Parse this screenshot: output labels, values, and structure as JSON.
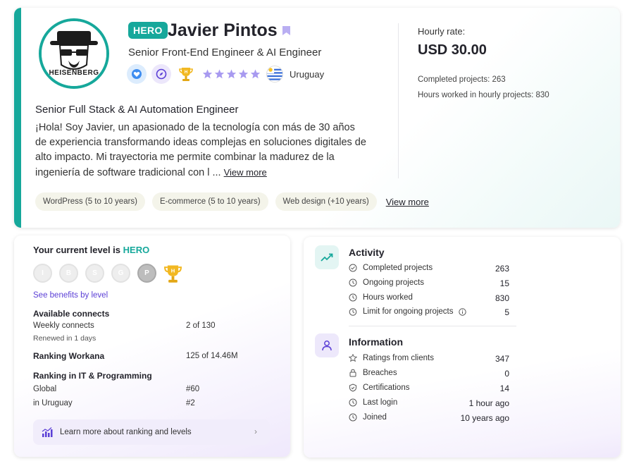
{
  "profile": {
    "badge": "HERO",
    "name": "Javier Pintos",
    "subtitle": "Senior Front-End Engineer & AI Engineer",
    "country": "Uruguay",
    "avatar_text": "HEISENBERG",
    "headline": "Senior Full Stack & AI Automation Engineer",
    "bio": "¡Hola! Soy Javier, un apasionado de la tecnología con más de 30 años de experiencia transformando ideas complejas en soluciones digitales de alto impacto. Mi trayectoria me permite combinar la madurez de la ingeniería de software tradicional con l ...",
    "bio_more": "View more",
    "skills": [
      "WordPress (5 to 10 years)",
      "E-commerce (5 to 10 years)",
      "Web design (+10 years)"
    ],
    "skills_more": "View more",
    "rating_stars": 5
  },
  "rate": {
    "label": "Hourly rate:",
    "value": "USD 30.00",
    "completed": "Completed projects: 263",
    "hours": "Hours worked in hourly projects: 830"
  },
  "level": {
    "title_prefix": "Your current level is",
    "title_level": "HERO",
    "level_badges": [
      "I",
      "B",
      "S",
      "G",
      "P",
      "H"
    ],
    "benefits_link": "See benefits by level",
    "connects_title": "Available connects",
    "weekly_label": "Weekly connects",
    "weekly_value": "2 of 130",
    "renewed": "Renewed in 1 days",
    "ranking_title": "Ranking Workana",
    "ranking_value": "125 of 14.46M",
    "it_title": "Ranking in IT & Programming",
    "global_label": "Global",
    "global_value": "#60",
    "uy_label": "in Uruguay",
    "uy_value": "#2",
    "learn_more": "Learn more about ranking and levels"
  },
  "activity": {
    "title": "Activity",
    "rows": [
      {
        "label": "Completed projects",
        "value": "263"
      },
      {
        "label": "Ongoing projects",
        "value": "15"
      },
      {
        "label": "Hours worked",
        "value": "830"
      },
      {
        "label": "Limit for ongoing projects",
        "value": "5"
      }
    ]
  },
  "information": {
    "title": "Information",
    "rows": [
      {
        "label": "Ratings from clients",
        "value": "347"
      },
      {
        "label": "Breaches",
        "value": "0"
      },
      {
        "label": "Certifications",
        "value": "14"
      },
      {
        "label": "Last login",
        "value": "1 hour ago"
      },
      {
        "label": "Joined",
        "value": "10 years ago"
      }
    ]
  },
  "colors": {
    "accent": "#16a89b",
    "purple": "#5b3fd6",
    "star": "#a89af0"
  }
}
